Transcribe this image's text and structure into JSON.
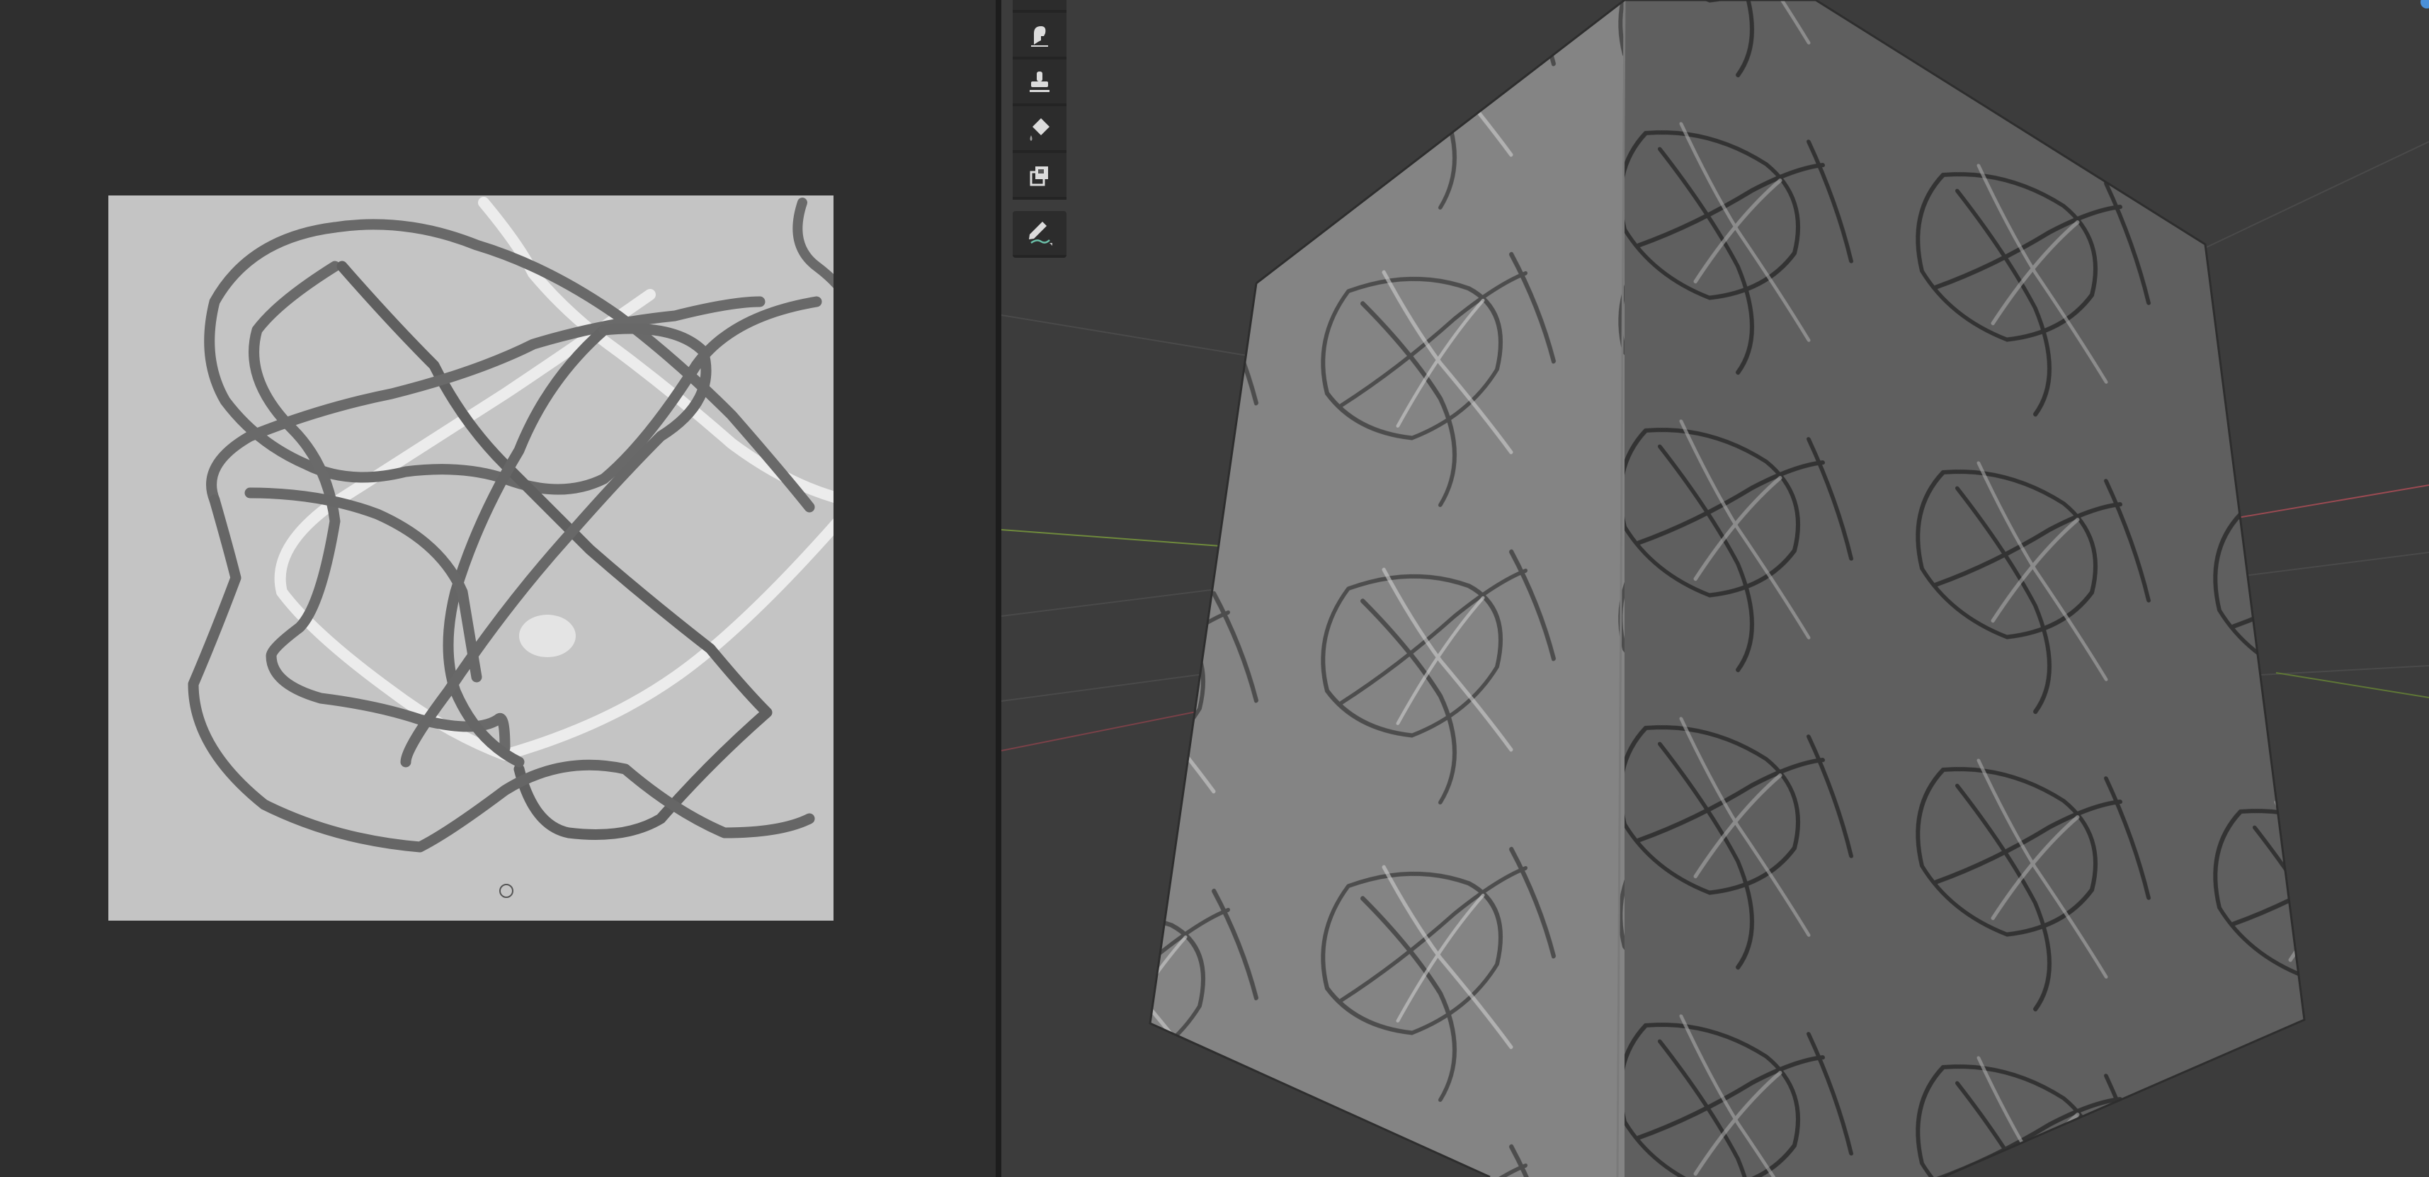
{
  "app": {
    "accent_color": "#4a90d9",
    "background_color": "#303030",
    "texture_background": "#c4c4c4",
    "stroke_dark": "#686868",
    "stroke_light": "#eeeeee"
  },
  "image_editor": {
    "cursor_icon": "brush-cursor-circle-icon"
  },
  "toolbar": {
    "tools": [
      {
        "name": "tool-top-partial",
        "icon": "tool-partial-icon"
      },
      {
        "name": "tool-smear",
        "icon": "smear-icon"
      },
      {
        "name": "tool-clone",
        "icon": "clone-stamp-icon"
      },
      {
        "name": "tool-fill",
        "icon": "fill-bucket-icon"
      },
      {
        "name": "tool-mask",
        "icon": "mask-icon"
      },
      {
        "name": "tool-annotate",
        "icon": "annotate-pencil-icon"
      }
    ]
  },
  "viewport_3d": {
    "object": "textured-cube",
    "axis_x_color": "#9a4a52",
    "axis_y_color": "#6f8a3c"
  }
}
